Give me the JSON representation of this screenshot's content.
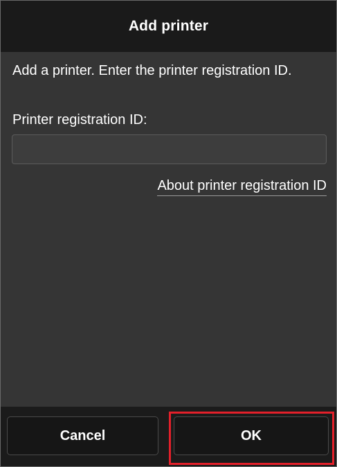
{
  "header": {
    "title": "Add printer"
  },
  "main": {
    "instruction": "Add a printer. Enter the printer registration ID.",
    "field_label": "Printer registration ID:",
    "registration_id": {
      "value": "",
      "placeholder": ""
    },
    "about_link": "About printer registration ID"
  },
  "footer": {
    "cancel_label": "Cancel",
    "ok_label": "OK"
  },
  "colors": {
    "header_bg": "#1a1a1a",
    "content_bg": "#353535",
    "footer_bg": "#1b1b1b",
    "highlight": "#e3202a"
  }
}
